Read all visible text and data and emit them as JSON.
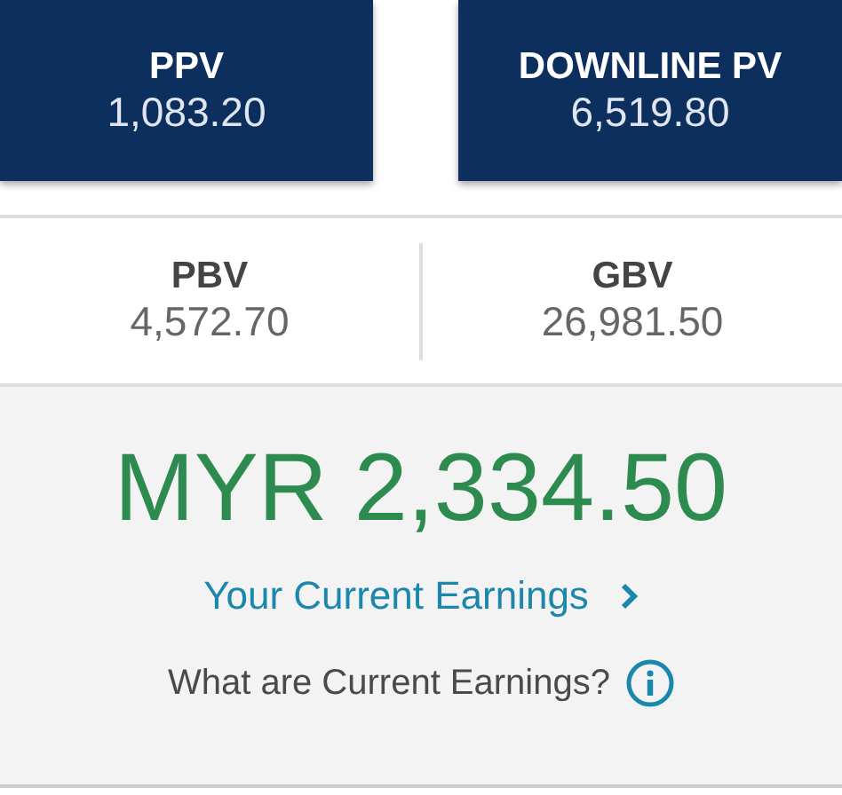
{
  "metric_rows": [
    {
      "kind": "highlight",
      "tiles": [
        {
          "label": "PPV",
          "value": "1,083.20"
        },
        {
          "label": "DOWNLINE PV",
          "value": "6,519.80"
        }
      ]
    },
    {
      "kind": "plain",
      "tiles": [
        {
          "label": "PBV",
          "value": "4,572.70"
        },
        {
          "label": "GBV",
          "value": "26,981.50"
        }
      ]
    }
  ],
  "earnings": {
    "amount": "MYR 2,334.50",
    "link": "Your Current Earnings",
    "question": "What are Current Earnings?"
  }
}
